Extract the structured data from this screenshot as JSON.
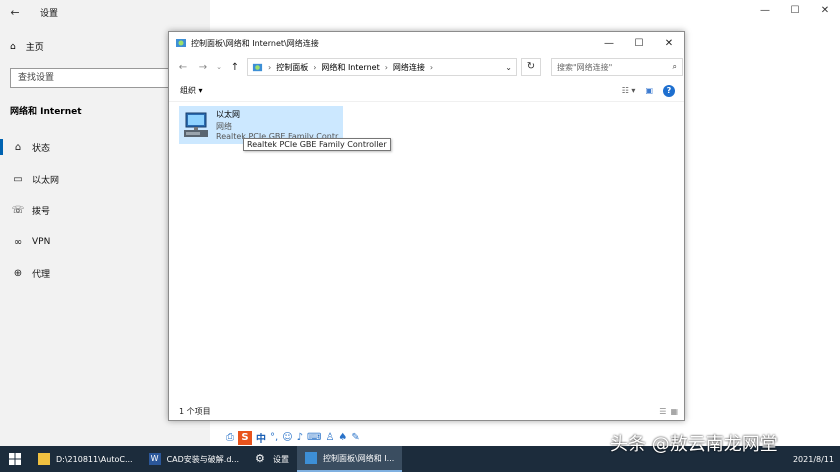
{
  "settings": {
    "back_label": "←",
    "title": "设置",
    "home": "主页",
    "search_placeholder": "查找设置",
    "section": "网络和 Internet",
    "nav": [
      {
        "label": "状态",
        "icon": "status-icon",
        "glyph": "⌂"
      },
      {
        "label": "以太网",
        "icon": "ethernet-icon",
        "glyph": "▭"
      },
      {
        "label": "拨号",
        "icon": "dialup-icon",
        "glyph": "☏"
      },
      {
        "label": "VPN",
        "icon": "vpn-icon",
        "glyph": "∞"
      },
      {
        "label": "代理",
        "icon": "proxy-icon",
        "glyph": "⊕"
      }
    ]
  },
  "window_controls": {
    "minimize": "—",
    "maximize": "☐",
    "close": "✕"
  },
  "explorer": {
    "title": "控制面板\\网络和 Internet\\网络连接",
    "breadcrumb": [
      "控制面板",
      "网络和 Internet",
      "网络连接"
    ],
    "search_placeholder": "搜索\"网络连接\"",
    "organize": "组织 ▾",
    "item": {
      "name": "以太网",
      "status": "网络",
      "device": "Realtek PCIe GBE Family Contr"
    },
    "tooltip": "Realtek PCIe GBE Family Controller",
    "status_count": "1 个项目"
  },
  "ime_bar": {
    "brand": "S",
    "mode": "中"
  },
  "taskbar": {
    "items": [
      {
        "label": "D:\\210811\\AutoC...",
        "icon": "folder-icon"
      },
      {
        "label": "CAD安装与破解.d...",
        "icon": "word-icon"
      },
      {
        "label": "设置",
        "icon": "settings-gear-icon"
      },
      {
        "label": "控制面板\\网络和 I...",
        "icon": "control-panel-icon"
      }
    ],
    "date": "2021/8/11"
  },
  "watermark": "头条 @敖云南龙网堂",
  "colors": {
    "accent": "#0063b1",
    "selection": "#cce8ff",
    "taskbar": "#1c2c3c"
  }
}
